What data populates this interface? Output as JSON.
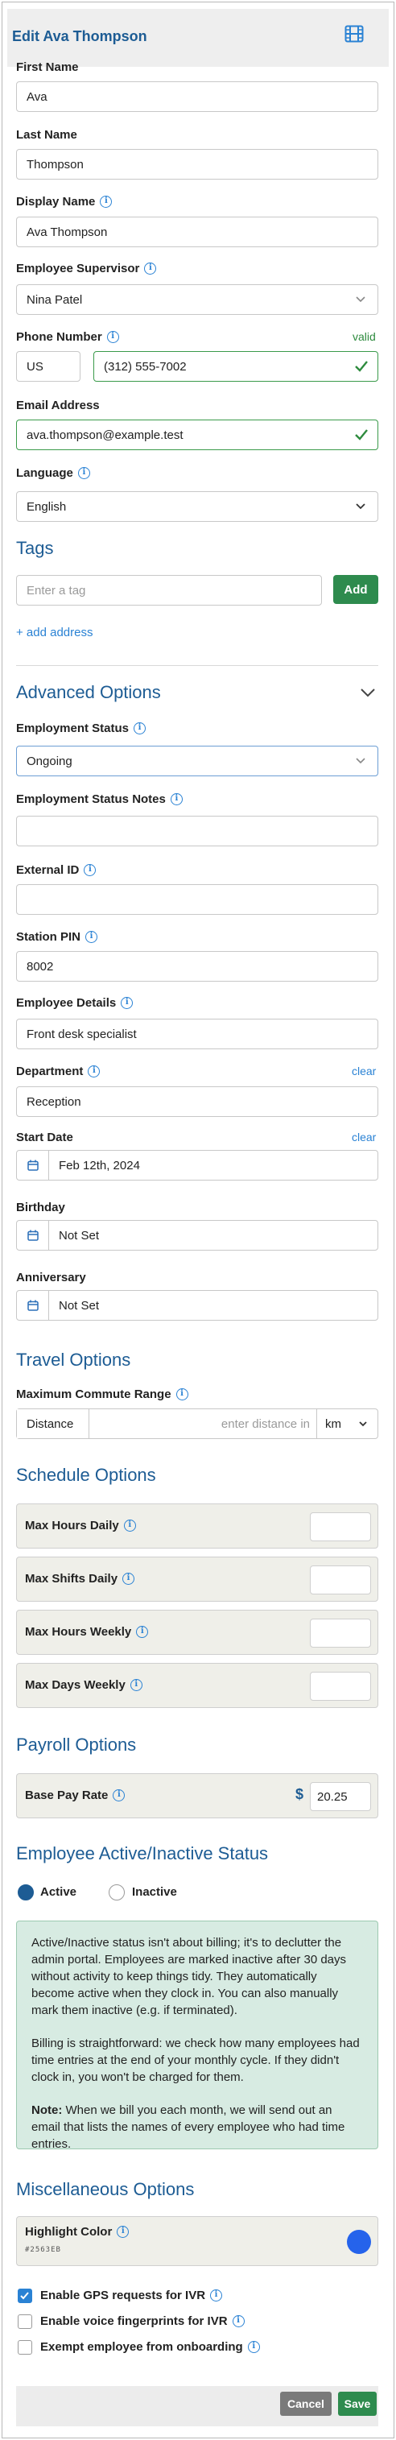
{
  "header": {
    "title": "Edit Ava Thompson",
    "icon": "film-icon"
  },
  "fields": {
    "first_name": {
      "label": "First Name",
      "value": "Ava"
    },
    "last_name": {
      "label": "Last Name",
      "value": "Thompson"
    },
    "display_name": {
      "label": "Display Name",
      "value": "Ava Thompson"
    },
    "supervisor": {
      "label": "Employee Supervisor",
      "value": "Nina Patel"
    },
    "phone": {
      "label": "Phone Number",
      "status": "valid",
      "country": "US",
      "value": "(312) 555-7002"
    },
    "email": {
      "label": "Email Address",
      "value": "ava.thompson@example.test"
    },
    "language": {
      "label": "Language",
      "value": "English"
    }
  },
  "tags": {
    "heading": "Tags",
    "placeholder": "Enter a tag",
    "add_label": "Add",
    "add_address": "+ add address"
  },
  "advanced": {
    "heading": "Advanced Options",
    "employment_status": {
      "label": "Employment Status",
      "value": "Ongoing"
    },
    "employment_status_notes": {
      "label": "Employment Status Notes",
      "value": ""
    },
    "external_id": {
      "label": "External ID",
      "value": ""
    },
    "station_pin": {
      "label": "Station PIN",
      "value": "8002"
    },
    "employee_details": {
      "label": "Employee Details",
      "value": "Front desk specialist"
    },
    "department": {
      "label": "Department",
      "clear": "clear",
      "value": "Reception"
    },
    "start_date": {
      "label": "Start Date",
      "clear": "clear",
      "value": "Feb 12th, 2024"
    },
    "birthday": {
      "label": "Birthday",
      "value": "Not Set"
    },
    "anniversary": {
      "label": "Anniversary",
      "value": "Not Set"
    }
  },
  "travel": {
    "heading": "Travel Options",
    "commute_label": "Maximum Commute Range",
    "prefix": "Distance",
    "placeholder": "enter distance in",
    "unit": "km"
  },
  "schedule": {
    "heading": "Schedule Options",
    "rows": [
      {
        "label": "Max Hours Daily",
        "value": ""
      },
      {
        "label": "Max Shifts Daily",
        "value": ""
      },
      {
        "label": "Max Hours Weekly",
        "value": ""
      },
      {
        "label": "Max Days Weekly",
        "value": ""
      }
    ]
  },
  "payroll": {
    "heading": "Payroll Options",
    "label": "Base Pay Rate",
    "currency": "$",
    "value": "20.25"
  },
  "status": {
    "heading": "Employee Active/Inactive Status",
    "active": "Active",
    "inactive": "Inactive",
    "selected": "Active",
    "note1": "Active/Inactive status isn't about billing; it's to declutter the admin portal. Employees are marked inactive after 30 days without activity to keep things tidy. They automatically become active when they clock in. You can also manually mark them inactive (e.g. if terminated).",
    "note2": "Billing is straightforward: we check how many employees had time entries at the end of your monthly cycle. If they didn't clock in, you won't be charged for them.",
    "note3_bold": "Note:",
    "note3": " When we bill you each month, we will send out an email that lists the names of every employee who had time entries."
  },
  "misc": {
    "heading": "Miscellaneous Options",
    "highlight_label": "Highlight Color",
    "highlight_hex": "#2563EB",
    "checkboxes": [
      {
        "label": "Enable GPS requests for IVR",
        "checked": true
      },
      {
        "label": "Enable voice fingerprints for IVR",
        "checked": false
      },
      {
        "label": "Exempt employee from onboarding",
        "checked": false
      }
    ]
  },
  "footer": {
    "cancel": "Cancel",
    "save": "Save"
  },
  "colors": {
    "brand": "#1d5c94",
    "accent": "#2a82d4",
    "success": "#2e8b4e",
    "highlight": "#2563EB"
  }
}
